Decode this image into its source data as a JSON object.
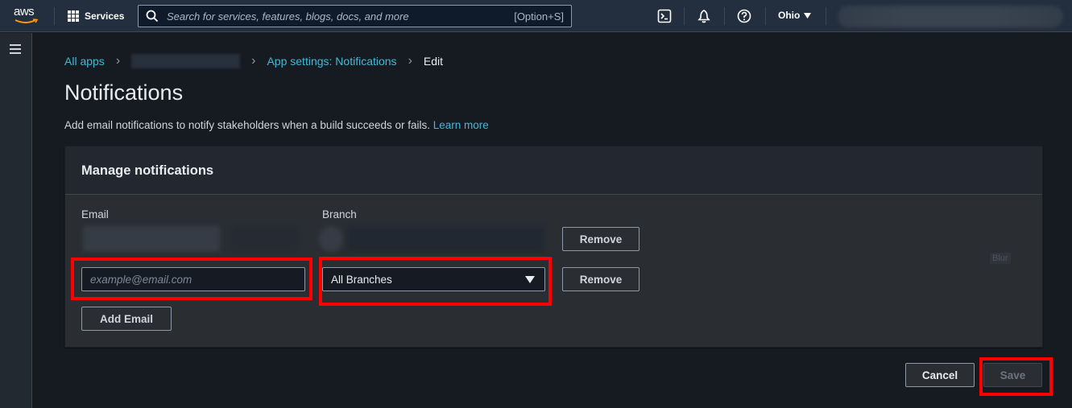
{
  "topnav": {
    "logo_text": "aws",
    "services_label": "Services",
    "search_placeholder": "Search for services, features, blogs, docs, and more",
    "search_shortcut": "[Option+S]",
    "region_label": "Ohio",
    "icons": [
      "cloudshell-icon",
      "bell-icon",
      "help-icon"
    ]
  },
  "breadcrumb": {
    "items": [
      {
        "label": "All apps",
        "link": true
      },
      {
        "label": "",
        "link": true,
        "redacted": true
      },
      {
        "label": "App settings: Notifications",
        "link": true
      },
      {
        "label": "Edit",
        "link": false
      }
    ]
  },
  "page": {
    "title": "Notifications",
    "description": "Add email notifications to notify stakeholders when a build succeeds or fails.",
    "learn_more": "Learn more"
  },
  "panel": {
    "title": "Manage notifications",
    "email_label": "Email",
    "branch_label": "Branch",
    "rows": [
      {
        "email": "",
        "branch": "",
        "redacted": true,
        "remove_label": "Remove"
      },
      {
        "email": "",
        "email_placeholder": "example@email.com",
        "branch": "All Branches",
        "remove_label": "Remove"
      }
    ],
    "add_email_label": "Add Email",
    "blur_tag": "Blur"
  },
  "footer": {
    "cancel_label": "Cancel",
    "save_label": "Save"
  },
  "colors": {
    "link": "#44b9d6",
    "header_bg": "#232f3e",
    "highlight": "#ff0000",
    "aws_orange": "#ff9900"
  }
}
